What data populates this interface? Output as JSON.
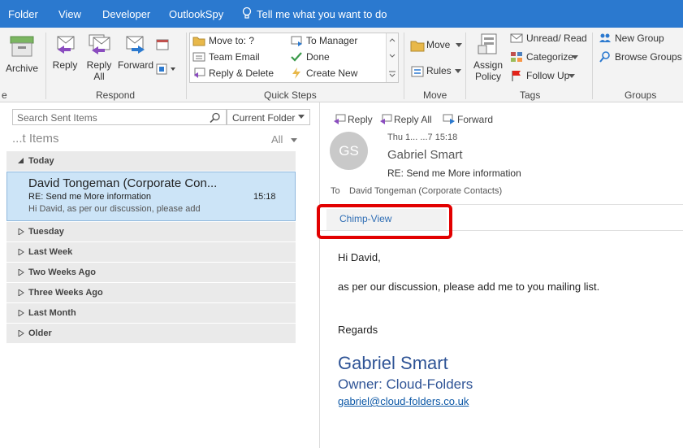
{
  "menu": {
    "items": [
      "Folder",
      "View",
      "Developer",
      "OutlookSpy"
    ],
    "tell_me": "Tell me what you want to do"
  },
  "ribbon": {
    "archive_label": "Archive",
    "respond": {
      "label": "Respond",
      "reply": "Reply",
      "reply_all_line1": "Reply",
      "reply_all_line2": "All",
      "forward": "Forward"
    },
    "quick_steps": {
      "label": "Quick Steps",
      "items": [
        "Move to: ?",
        "Team Email",
        "Reply & Delete",
        "To Manager",
        "Done",
        "Create New"
      ]
    },
    "move": {
      "label": "Move",
      "move_btn": "Move",
      "rules_btn": "Rules"
    },
    "tags": {
      "label": "Tags",
      "assign_line1": "Assign",
      "assign_line2": "Policy",
      "unread_read": "Unread/ Read",
      "categorize": "Categorize",
      "follow_up": "Follow Up"
    },
    "groups": {
      "label": "Groups",
      "new_group": "New Group",
      "browse_groups": "Browse Groups"
    }
  },
  "list": {
    "search_placeholder": "Search Sent Items",
    "scope": "Current Folder",
    "folder_title": "...t Items",
    "filter": "All",
    "groups": [
      "Today",
      "Tuesday",
      "Last Week",
      "Two Weeks Ago",
      "Three Weeks Ago",
      "Last Month",
      "Older"
    ],
    "selected": {
      "from": "David Tongeman (Corporate Con...",
      "subject": "RE: Send me More information",
      "time": "15:18",
      "preview": "Hi David,  as per our discussion, please add"
    }
  },
  "reading": {
    "actions": {
      "reply": "Reply",
      "reply_all": "Reply All",
      "forward": "Forward"
    },
    "avatar_initials": "GS",
    "date": "Thu 1... ...7 15:18",
    "sender": "Gabriel Smart",
    "subject": "RE: Send me More information",
    "to_label": "To",
    "to": "David Tongeman (Corporate Contacts)",
    "addin": "Chimp-View",
    "body": {
      "greeting": "Hi David,",
      "line1": "as per our discussion, please add me to you mailing list.",
      "regards": "Regards"
    },
    "signature": {
      "name": "Gabriel Smart",
      "role": "Owner: Cloud-Folders",
      "email": "gabriel@cloud-folders.co.uk"
    }
  },
  "colors": {
    "menubar": "#2b79cf",
    "selection": "#cce4f7",
    "highlight_box": "#e20000",
    "signature": "#2f5496"
  }
}
